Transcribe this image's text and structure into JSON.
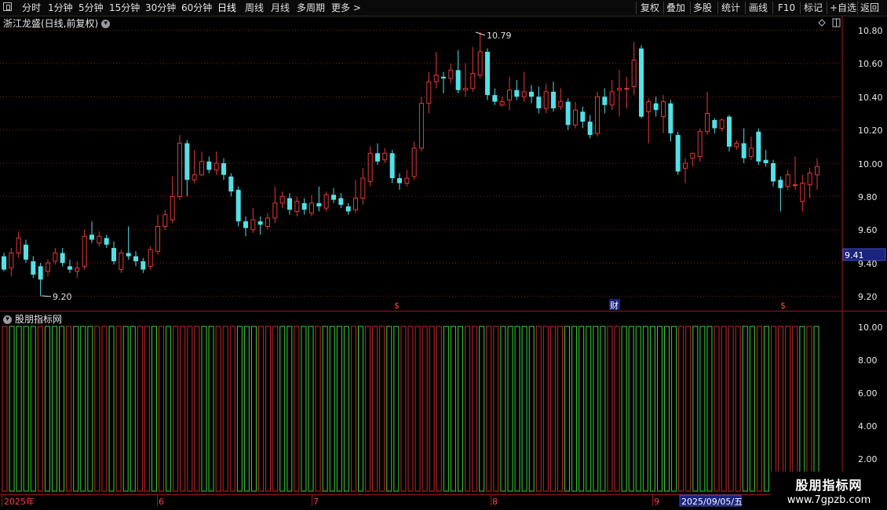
{
  "toolbar": {
    "periods": [
      "分时",
      "1分钟",
      "5分钟",
      "15分钟",
      "30分钟",
      "60分钟",
      "日线",
      "周线",
      "月线",
      "多周期",
      "更多 >"
    ],
    "active_period": "日线",
    "right_buttons": [
      "复权",
      "叠加",
      "多股",
      "统计",
      "画线",
      "F10",
      "标记",
      "+自选",
      "返回"
    ]
  },
  "chart": {
    "title": "浙江龙盛(日线,前复权)",
    "price_axis_labels": [
      "10.80",
      "10.60",
      "10.40",
      "10.20",
      "10.00",
      "9.80",
      "9.60",
      "9.40",
      "9.20"
    ],
    "current_price": "9.41",
    "high_label": "10.79",
    "low_label": "9.20",
    "event_markers": [
      "$",
      "财",
      "$"
    ]
  },
  "indicator": {
    "title": "股朋指标网",
    "axis_labels": [
      "10.00",
      "8.00",
      "6.00",
      "4.00",
      "2.00"
    ]
  },
  "date_axis": {
    "labels": [
      "2025年",
      "6",
      "7",
      "8",
      "9"
    ],
    "cursor_date": "2025/09/05/五"
  },
  "watermark": {
    "name": "股朋指标网",
    "url": "www.7gpzb.com"
  },
  "colors": {
    "up": "#e53935",
    "down": "#53e0e6",
    "grid": "#8a1c1c",
    "ind_red": "#c62828",
    "ind_green": "#3bd13b",
    "cursor_bg": "#1a237e"
  },
  "chart_data": {
    "type": "candlestick",
    "ylim": [
      9.15,
      10.85
    ],
    "candles": [
      [
        9.44,
        9.36,
        9.46,
        9.35
      ],
      [
        9.37,
        9.46,
        9.49,
        9.32
      ],
      [
        9.46,
        9.55,
        9.59,
        9.43
      ],
      [
        9.51,
        9.42,
        9.54,
        9.4
      ],
      [
        9.41,
        9.33,
        9.44,
        9.31
      ],
      [
        9.38,
        9.3,
        9.4,
        9.2
      ],
      [
        9.35,
        9.4,
        9.42,
        9.32
      ],
      [
        9.41,
        9.46,
        9.49,
        9.39
      ],
      [
        9.46,
        9.4,
        9.49,
        9.38
      ],
      [
        9.38,
        9.36,
        9.42,
        9.34
      ],
      [
        9.35,
        9.37,
        9.41,
        9.31
      ],
      [
        9.38,
        9.56,
        9.6,
        9.36
      ],
      [
        9.57,
        9.54,
        9.65,
        9.52
      ],
      [
        9.52,
        9.56,
        9.59,
        9.5
      ],
      [
        9.55,
        9.51,
        9.57,
        9.49
      ],
      [
        9.49,
        9.41,
        9.53,
        9.39
      ],
      [
        9.36,
        9.46,
        9.48,
        9.34
      ],
      [
        9.46,
        9.44,
        9.62,
        9.42
      ],
      [
        9.44,
        9.41,
        9.47,
        9.38
      ],
      [
        9.41,
        9.36,
        9.43,
        9.34
      ],
      [
        9.38,
        9.48,
        9.5,
        9.36
      ],
      [
        9.47,
        9.62,
        9.69,
        9.45
      ],
      [
        9.62,
        9.69,
        9.72,
        9.6
      ],
      [
        9.66,
        9.8,
        9.92,
        9.64
      ],
      [
        9.8,
        10.12,
        10.17,
        9.78
      ],
      [
        10.12,
        9.9,
        10.14,
        9.8
      ],
      [
        9.9,
        9.93,
        10.08,
        9.88
      ],
      [
        9.93,
        10.01,
        10.07,
        9.92
      ],
      [
        10.01,
        9.96,
        10.04,
        9.94
      ],
      [
        9.96,
        10.0,
        10.07,
        9.93
      ],
      [
        10.0,
        9.93,
        10.03,
        9.9
      ],
      [
        9.92,
        9.83,
        9.94,
        9.8
      ],
      [
        9.84,
        9.65,
        9.86,
        9.62
      ],
      [
        9.65,
        9.61,
        9.68,
        9.56
      ],
      [
        9.6,
        9.66,
        9.73,
        9.58
      ],
      [
        9.65,
        9.63,
        9.68,
        9.57
      ],
      [
        9.62,
        9.67,
        9.7,
        9.6
      ],
      [
        9.67,
        9.76,
        9.86,
        9.64
      ],
      [
        9.76,
        9.8,
        9.83,
        9.73
      ],
      [
        9.79,
        9.72,
        9.82,
        9.69
      ],
      [
        9.71,
        9.77,
        9.8,
        9.68
      ],
      [
        9.76,
        9.72,
        9.79,
        9.69
      ],
      [
        9.7,
        9.76,
        9.81,
        9.68
      ],
      [
        9.76,
        9.74,
        9.86,
        9.71
      ],
      [
        9.73,
        9.81,
        9.83,
        9.71
      ],
      [
        9.81,
        9.78,
        9.85,
        9.76
      ],
      [
        9.79,
        9.75,
        9.82,
        9.73
      ],
      [
        9.74,
        9.71,
        9.76,
        9.69
      ],
      [
        9.72,
        9.79,
        9.9,
        9.7
      ],
      [
        9.79,
        9.91,
        9.97,
        9.75
      ],
      [
        9.89,
        10.06,
        10.1,
        9.86
      ],
      [
        10.06,
        10.01,
        10.12,
        9.99
      ],
      [
        10.02,
        10.06,
        10.09,
        10.0
      ],
      [
        10.06,
        9.91,
        10.08,
        9.88
      ],
      [
        9.91,
        9.88,
        9.94,
        9.84
      ],
      [
        9.88,
        9.91,
        9.96,
        9.86
      ],
      [
        9.92,
        10.09,
        10.13,
        9.9
      ],
      [
        10.09,
        10.36,
        10.4,
        10.07
      ],
      [
        10.36,
        10.49,
        10.55,
        10.3
      ],
      [
        10.49,
        10.53,
        10.67,
        10.45
      ],
      [
        10.52,
        10.51,
        10.55,
        10.42
      ],
      [
        10.51,
        10.56,
        10.6,
        10.48
      ],
      [
        10.56,
        10.44,
        10.68,
        10.42
      ],
      [
        10.44,
        10.45,
        10.6,
        10.4
      ],
      [
        10.45,
        10.54,
        10.7,
        10.43
      ],
      [
        10.53,
        10.67,
        10.79,
        10.51
      ],
      [
        10.67,
        10.41,
        10.69,
        10.38
      ],
      [
        10.41,
        10.37,
        10.45,
        10.35
      ],
      [
        10.35,
        10.37,
        10.4,
        10.34
      ],
      [
        10.38,
        10.44,
        10.52,
        10.32
      ],
      [
        10.44,
        10.4,
        10.5,
        10.38
      ],
      [
        10.4,
        10.43,
        10.55,
        10.37
      ],
      [
        10.43,
        10.4,
        10.47,
        10.36
      ],
      [
        10.4,
        10.33,
        10.46,
        10.3
      ],
      [
        10.33,
        10.43,
        10.48,
        10.3
      ],
      [
        10.43,
        10.33,
        10.49,
        10.31
      ],
      [
        10.34,
        10.37,
        10.45,
        10.32
      ],
      [
        10.37,
        10.23,
        10.39,
        10.2
      ],
      [
        10.23,
        10.32,
        10.37,
        10.21
      ],
      [
        10.31,
        10.25,
        10.34,
        10.21
      ],
      [
        10.25,
        10.17,
        10.29,
        10.15
      ],
      [
        10.18,
        10.4,
        10.43,
        10.16
      ],
      [
        10.4,
        10.35,
        10.45,
        10.3
      ],
      [
        10.35,
        10.43,
        10.5,
        10.32
      ],
      [
        10.44,
        10.45,
        10.56,
        10.28
      ],
      [
        10.45,
        10.45,
        10.52,
        10.33
      ],
      [
        10.46,
        10.62,
        10.73,
        10.41
      ],
      [
        10.69,
        10.28,
        10.71,
        10.27
      ],
      [
        10.31,
        10.37,
        10.39,
        10.12
      ],
      [
        10.36,
        10.32,
        10.4,
        10.28
      ],
      [
        10.28,
        10.37,
        10.41,
        10.18
      ],
      [
        10.36,
        10.18,
        10.38,
        10.13
      ],
      [
        10.17,
        9.95,
        10.19,
        9.93
      ],
      [
        9.97,
        10.0,
        10.03,
        9.88
      ],
      [
        10.03,
        10.06,
        10.05,
        9.98
      ],
      [
        10.04,
        10.19,
        10.21,
        10.01
      ],
      [
        10.19,
        10.3,
        10.43,
        10.17
      ],
      [
        10.26,
        10.21,
        10.27,
        10.18
      ],
      [
        10.21,
        10.26,
        10.27,
        10.19
      ],
      [
        10.28,
        10.1,
        10.29,
        10.07
      ],
      [
        10.1,
        10.12,
        10.14,
        10.08
      ],
      [
        10.12,
        10.03,
        10.21,
        10.0
      ],
      [
        10.04,
        10.09,
        10.16,
        10.02
      ],
      [
        10.19,
        10.01,
        10.21,
        9.99
      ],
      [
        10.02,
        10.0,
        10.08,
        9.98
      ],
      [
        10.0,
        9.89,
        10.02,
        9.86
      ],
      [
        9.9,
        9.85,
        9.92,
        9.71
      ],
      [
        9.86,
        9.93,
        9.96,
        9.84
      ],
      [
        9.87,
        9.87,
        10.04,
        9.84
      ],
      [
        9.77,
        9.88,
        9.93,
        9.71
      ],
      [
        9.87,
        9.94,
        9.97,
        9.79
      ],
      [
        9.93,
        9.98,
        10.03,
        9.84
      ]
    ],
    "indicator_ylim": [
      0,
      10.8
    ],
    "indicator_bars": [
      [
        "r",
        10
      ],
      [
        "g",
        10
      ],
      [
        "g",
        10
      ],
      [
        "g",
        10
      ],
      [
        "g",
        10
      ],
      [
        "r",
        10
      ],
      [
        "g",
        10
      ],
      [
        "g",
        10
      ],
      [
        "g",
        10
      ],
      [
        "r",
        10
      ],
      [
        "g",
        10
      ],
      [
        "g",
        10
      ],
      [
        "g",
        10
      ],
      [
        "r",
        10
      ],
      [
        "r",
        10
      ],
      [
        "g",
        10
      ],
      [
        "r",
        10
      ],
      [
        "g",
        10
      ],
      [
        "g",
        10
      ],
      [
        "r",
        10
      ],
      [
        "r",
        10
      ],
      [
        "g",
        10
      ],
      [
        "r",
        10
      ],
      [
        "g",
        10
      ],
      [
        "r",
        10
      ],
      [
        "r",
        10
      ],
      [
        "r",
        10
      ],
      [
        "r",
        10
      ],
      [
        "g",
        10
      ],
      [
        "g",
        10
      ],
      [
        "r",
        10
      ],
      [
        "r",
        10
      ],
      [
        "r",
        10
      ],
      [
        "g",
        10
      ],
      [
        "g",
        10
      ],
      [
        "g",
        10
      ],
      [
        "r",
        10
      ],
      [
        "r",
        10
      ],
      [
        "r",
        10
      ],
      [
        "g",
        10
      ],
      [
        "g",
        10
      ],
      [
        "r",
        10
      ],
      [
        "g",
        10
      ],
      [
        "g",
        10
      ],
      [
        "r",
        10
      ],
      [
        "g",
        10
      ],
      [
        "g",
        10
      ],
      [
        "g",
        10
      ],
      [
        "g",
        10
      ],
      [
        "r",
        10
      ],
      [
        "g",
        10
      ],
      [
        "r",
        10
      ],
      [
        "r",
        10
      ],
      [
        "r",
        10
      ],
      [
        "g",
        10
      ],
      [
        "g",
        10
      ],
      [
        "r",
        10
      ],
      [
        "r",
        10
      ],
      [
        "r",
        10
      ],
      [
        "r",
        10
      ],
      [
        "r",
        10
      ],
      [
        "r",
        10
      ],
      [
        "g",
        10
      ],
      [
        "g",
        10
      ],
      [
        "g",
        10
      ],
      [
        "r",
        10
      ],
      [
        "r",
        10
      ],
      [
        "g",
        10
      ],
      [
        "r",
        10
      ],
      [
        "r",
        10
      ],
      [
        "g",
        10
      ],
      [
        "g",
        10
      ],
      [
        "g",
        10
      ],
      [
        "g",
        10
      ],
      [
        "g",
        10
      ],
      [
        "r",
        10
      ],
      [
        "r",
        10
      ],
      [
        "r",
        10
      ],
      [
        "r",
        10
      ],
      [
        "g",
        10
      ],
      [
        "g",
        10
      ],
      [
        "g",
        10
      ],
      [
        "g",
        10
      ],
      [
        "g",
        10
      ],
      [
        "g",
        10
      ],
      [
        "r",
        10
      ],
      [
        "r",
        10
      ],
      [
        "g",
        10
      ],
      [
        "g",
        10
      ],
      [
        "g",
        10
      ],
      [
        "g",
        10
      ],
      [
        "g",
        10
      ],
      [
        "g",
        10
      ],
      [
        "g",
        10
      ],
      [
        "g",
        10
      ],
      [
        "r",
        10
      ],
      [
        "r",
        10
      ],
      [
        "g",
        10
      ],
      [
        "g",
        10
      ],
      [
        "g",
        10
      ],
      [
        "r",
        10
      ],
      [
        "r",
        10
      ],
      [
        "r",
        10
      ],
      [
        "r",
        10
      ],
      [
        "g",
        10
      ],
      [
        "g",
        10
      ],
      [
        "r",
        10
      ],
      [
        "g",
        10
      ],
      [
        "r",
        10
      ],
      [
        "r",
        10
      ],
      [
        "r",
        10
      ],
      [
        "r",
        10
      ],
      [
        "g",
        10
      ],
      [
        "r",
        10
      ],
      [
        "g",
        10
      ]
    ]
  }
}
